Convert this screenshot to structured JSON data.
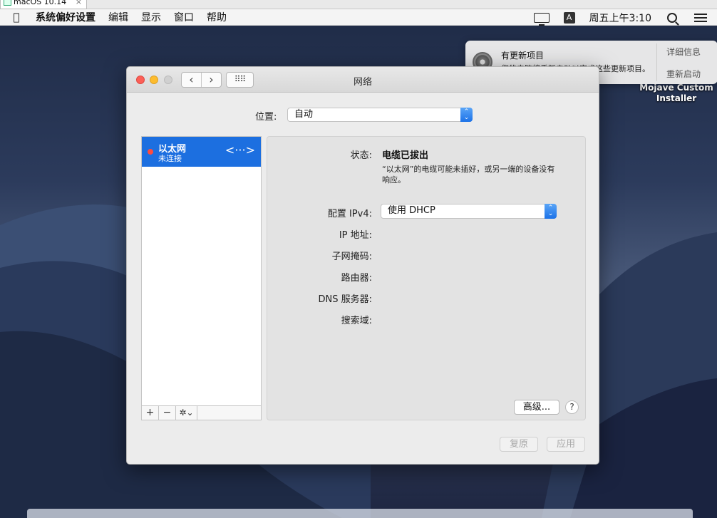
{
  "vm_tab": {
    "title": "macOS 10.14",
    "close": "×"
  },
  "menubar": {
    "apple": "",
    "app_name": "系统偏好设置",
    "items": [
      "编辑",
      "显示",
      "窗口",
      "帮助"
    ],
    "input_source": "A",
    "clock": "周五上午3:10"
  },
  "notification": {
    "title": "有更新项目",
    "body": "您的电脑将重新启动以完成这些更新项目。",
    "action_details": "详细信息",
    "action_restart": "重新启动"
  },
  "desktop": {
    "installer_label_line1": "Mojave Custom",
    "installer_label_line2": "Installer"
  },
  "window": {
    "title": "网络",
    "nav_back": "‹",
    "nav_forward": "›",
    "grid_icon": "⠿⠿",
    "location_label": "位置:",
    "location_value": "自动",
    "services": [
      {
        "name": "以太网",
        "status": "未连接"
      }
    ],
    "svc_add": "+",
    "svc_remove": "−",
    "svc_gear": "✲⌄",
    "detail": {
      "status_label": "状态:",
      "status_value": "电缆已拔出",
      "status_desc": "“以太网”的电缆可能未插好，或另一端的设备没有响应。",
      "ipv4_label": "配置 IPv4:",
      "ipv4_value": "使用 DHCP",
      "ip_label": "IP 地址:",
      "subnet_label": "子网掩码:",
      "router_label": "路由器:",
      "dns_label": "DNS 服务器:",
      "search_label": "搜索域:",
      "advanced_button": "高级...",
      "help": "?"
    },
    "revert_button": "复原",
    "apply_button": "应用"
  }
}
